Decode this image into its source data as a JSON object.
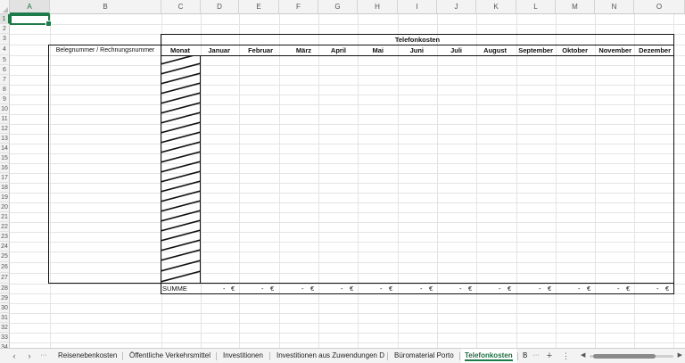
{
  "columns": [
    "A",
    "B",
    "C",
    "D",
    "E",
    "F",
    "G",
    "H",
    "I",
    "J",
    "K",
    "L",
    "M",
    "N",
    "O"
  ],
  "rows": [
    "1",
    "2",
    "3",
    "4",
    "5",
    "6",
    "7",
    "8",
    "9",
    "10",
    "11",
    "12",
    "13",
    "14",
    "15",
    "16",
    "17",
    "18",
    "19",
    "20",
    "21",
    "22",
    "23",
    "24",
    "25",
    "26",
    "27",
    "28",
    "29",
    "30",
    "31",
    "32",
    "33",
    "34"
  ],
  "selected_cell": "A1",
  "table": {
    "title": "Telefonkosten",
    "left_header": "Belegnummer / Rechnungsnummer",
    "month_header": "Monat",
    "months": [
      "Januar",
      "Februar",
      "März",
      "April",
      "Mai",
      "Juni",
      "Juli",
      "August",
      "September",
      "Oktober",
      "November",
      "Dezember"
    ],
    "sum_label": "SUMME",
    "sum_values": [
      "-",
      "-",
      "-",
      "-",
      "-",
      "-",
      "-",
      "-",
      "-",
      "-",
      "-",
      "-"
    ],
    "currency": "€"
  },
  "tabs": {
    "prev_icon": "‹",
    "next_icon": "›",
    "more_left": "···",
    "items": [
      "Reisenebenkosten",
      "Öffentliche Verkehrsmittel",
      "Investitionen",
      "Investitionen aus Zuwendungen D",
      "Büromaterial Porto",
      "Telefonkosten",
      "B"
    ],
    "active": "Telefonkosten",
    "more_right": "···",
    "add_icon": "+",
    "menu_icon": "⋮"
  },
  "colors": {
    "accent": "#1f7a4a",
    "grid": "#e4e4e4",
    "header_bg": "#f3f3f3",
    "border": "#111111"
  }
}
